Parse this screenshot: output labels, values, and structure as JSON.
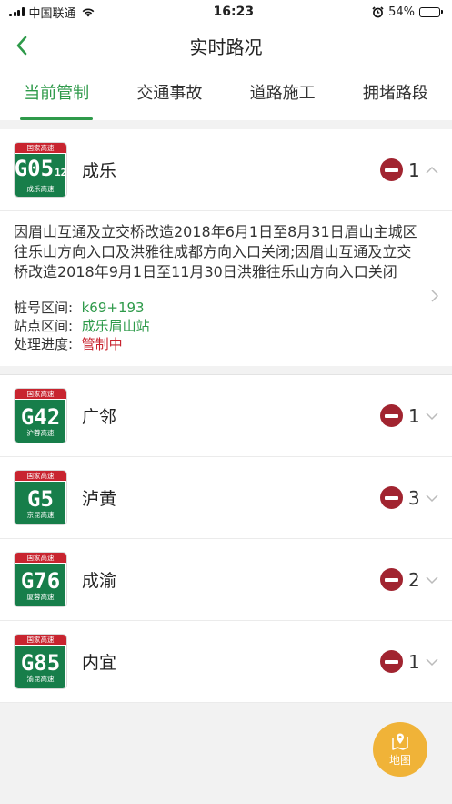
{
  "status_bar": {
    "carrier": "中国联通",
    "time": "16:23",
    "battery_percent": "54%",
    "battery_level": 0.54
  },
  "nav": {
    "title": "实时路况"
  },
  "tabs": [
    {
      "label": "当前管制",
      "active": true
    },
    {
      "label": "交通事故",
      "active": false
    },
    {
      "label": "道路施工",
      "active": false
    },
    {
      "label": "拥堵路段",
      "active": false
    }
  ],
  "shield_header": "国家高速",
  "detail_labels": {
    "stake": "桩号区间:",
    "station": "站点区间:",
    "progress": "处理进度:"
  },
  "roads": [
    {
      "code": "G05",
      "code_sub": "12",
      "shield_name": "成乐高速",
      "name": "成乐",
      "count": "1",
      "expanded": true,
      "detail": {
        "text": "因眉山互通及立交桥改造2018年6月1日至8月31日眉山主城区往乐山方向入口及洪雅往成都方向入口关闭;因眉山互通及立交桥改造2018年9月1日至11月30日洪雅往乐山方向入口关闭",
        "stake": "k69+193",
        "station": "成乐眉山站",
        "progress": "管制中"
      }
    },
    {
      "code": "G42",
      "code_sub": "",
      "shield_name": "沪蓉高速",
      "name": "广邻",
      "count": "1",
      "expanded": false
    },
    {
      "code": "G5",
      "code_sub": "",
      "shield_name": "京昆高速",
      "name": "泸黄",
      "count": "3",
      "expanded": false
    },
    {
      "code": "G76",
      "code_sub": "",
      "shield_name": "厦蓉高速",
      "name": "成渝",
      "count": "2",
      "expanded": false
    },
    {
      "code": "G85",
      "code_sub": "",
      "shield_name": "渝昆高速",
      "name": "内宜",
      "count": "1",
      "expanded": false
    }
  ],
  "map_button": {
    "label": "地图"
  },
  "colors": {
    "accent": "#2e9a4a",
    "shield_red": "#c8242f",
    "shield_green": "#177e4a",
    "no_entry": "#a12430",
    "map_button": "#f0b338"
  }
}
